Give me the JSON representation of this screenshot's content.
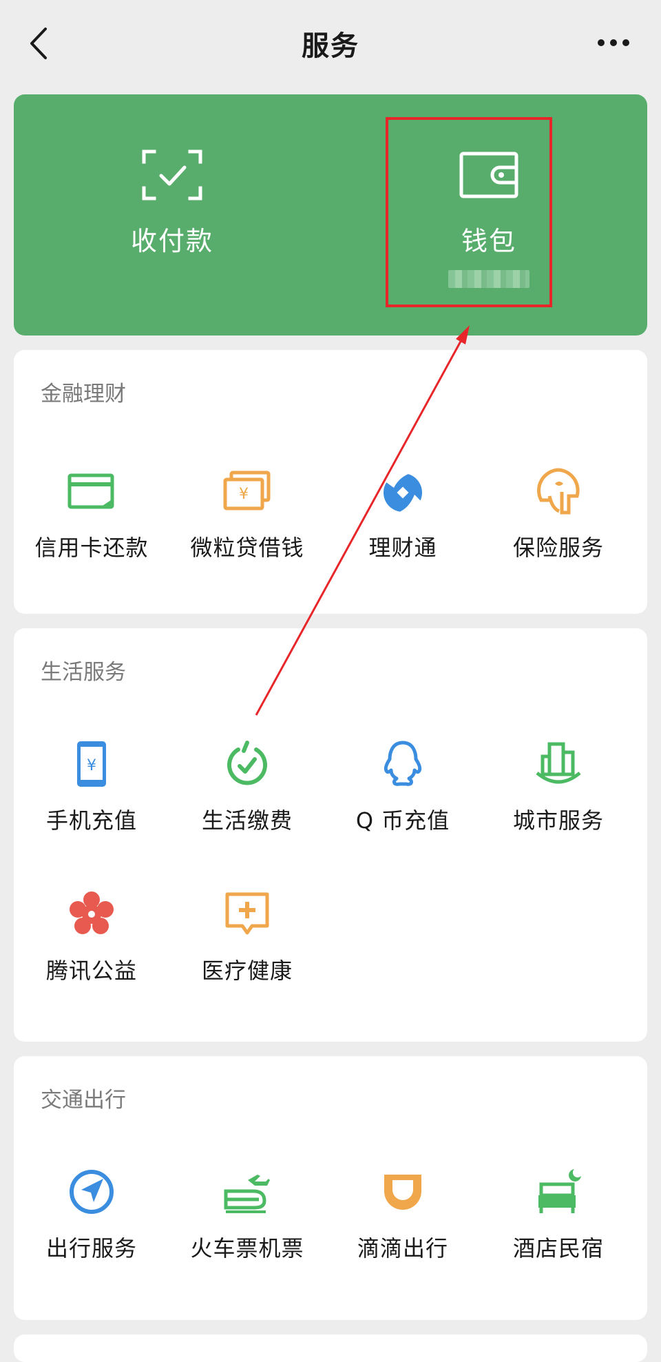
{
  "nav": {
    "title": "服务"
  },
  "top": {
    "pay": {
      "label": "收付款"
    },
    "wallet": {
      "label": "钱包"
    }
  },
  "finance": {
    "title": "金融理财",
    "items": [
      {
        "label": "信用卡还款",
        "icon": "credit-card-icon"
      },
      {
        "label": "微粒贷借钱",
        "icon": "loan-icon"
      },
      {
        "label": "理财通",
        "icon": "wealth-icon"
      },
      {
        "label": "保险服务",
        "icon": "insurance-icon"
      }
    ]
  },
  "life": {
    "title": "生活服务",
    "items": [
      {
        "label": "手机充值",
        "icon": "phone-recharge-icon"
      },
      {
        "label": "生活缴费",
        "icon": "utility-payment-icon"
      },
      {
        "label": "Q 币充值",
        "icon": "qq-coin-icon"
      },
      {
        "label": "城市服务",
        "icon": "city-service-icon"
      },
      {
        "label": "腾讯公益",
        "icon": "charity-icon"
      },
      {
        "label": "医疗健康",
        "icon": "medical-icon"
      }
    ]
  },
  "transport": {
    "title": "交通出行",
    "items": [
      {
        "label": "出行服务",
        "icon": "travel-icon"
      },
      {
        "label": "火车票机票",
        "icon": "train-plane-icon"
      },
      {
        "label": "滴滴出行",
        "icon": "didi-icon"
      },
      {
        "label": "酒店民宿",
        "icon": "hotel-icon"
      }
    ]
  },
  "colors": {
    "green_banner": "#58ad6c",
    "highlight": "#e8262a",
    "icon_green": "#4cb963",
    "icon_orange": "#f0a64a",
    "icon_blue": "#3b8de0",
    "icon_red": "#e85a4f"
  }
}
